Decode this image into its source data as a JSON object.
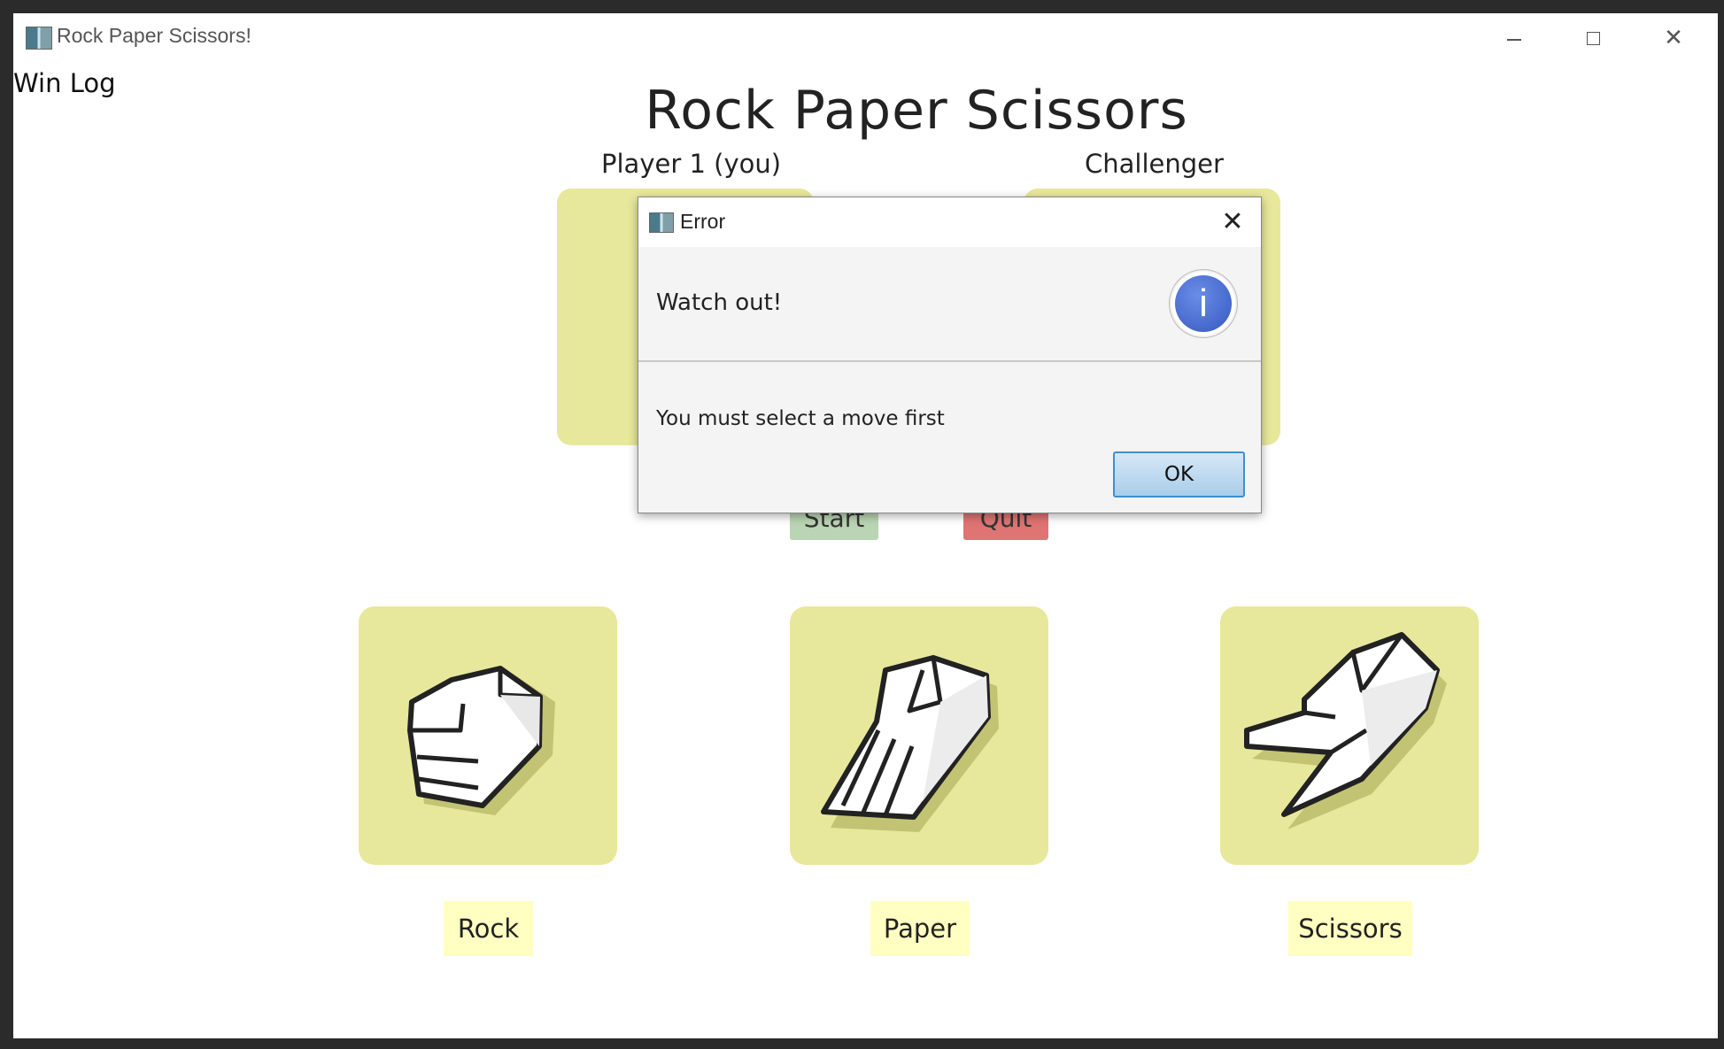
{
  "window": {
    "title": "Rock Paper Scissors!"
  },
  "win_log": "Win Log",
  "game": {
    "title": "Rock Paper Scissors",
    "player_label": "Player 1 (you)",
    "challenger_label": "Challenger",
    "start_label": "Start",
    "quit_label": "Quit",
    "moves": [
      {
        "label": "Rock",
        "icon": "rock-hand-icon"
      },
      {
        "label": "Paper",
        "icon": "paper-hand-icon"
      },
      {
        "label": "Scissors",
        "icon": "scissors-hand-icon"
      }
    ]
  },
  "dialog": {
    "title": "Error",
    "header": "Watch out!",
    "content": "You must select a move first",
    "ok_label": "OK",
    "icon": "info-icon"
  },
  "colors": {
    "panel": "#e8e89c",
    "move_label_bg": "#ffffc2",
    "start": "#b9d5b3",
    "quit": "#df7474",
    "info_blue": "#3558c0"
  }
}
